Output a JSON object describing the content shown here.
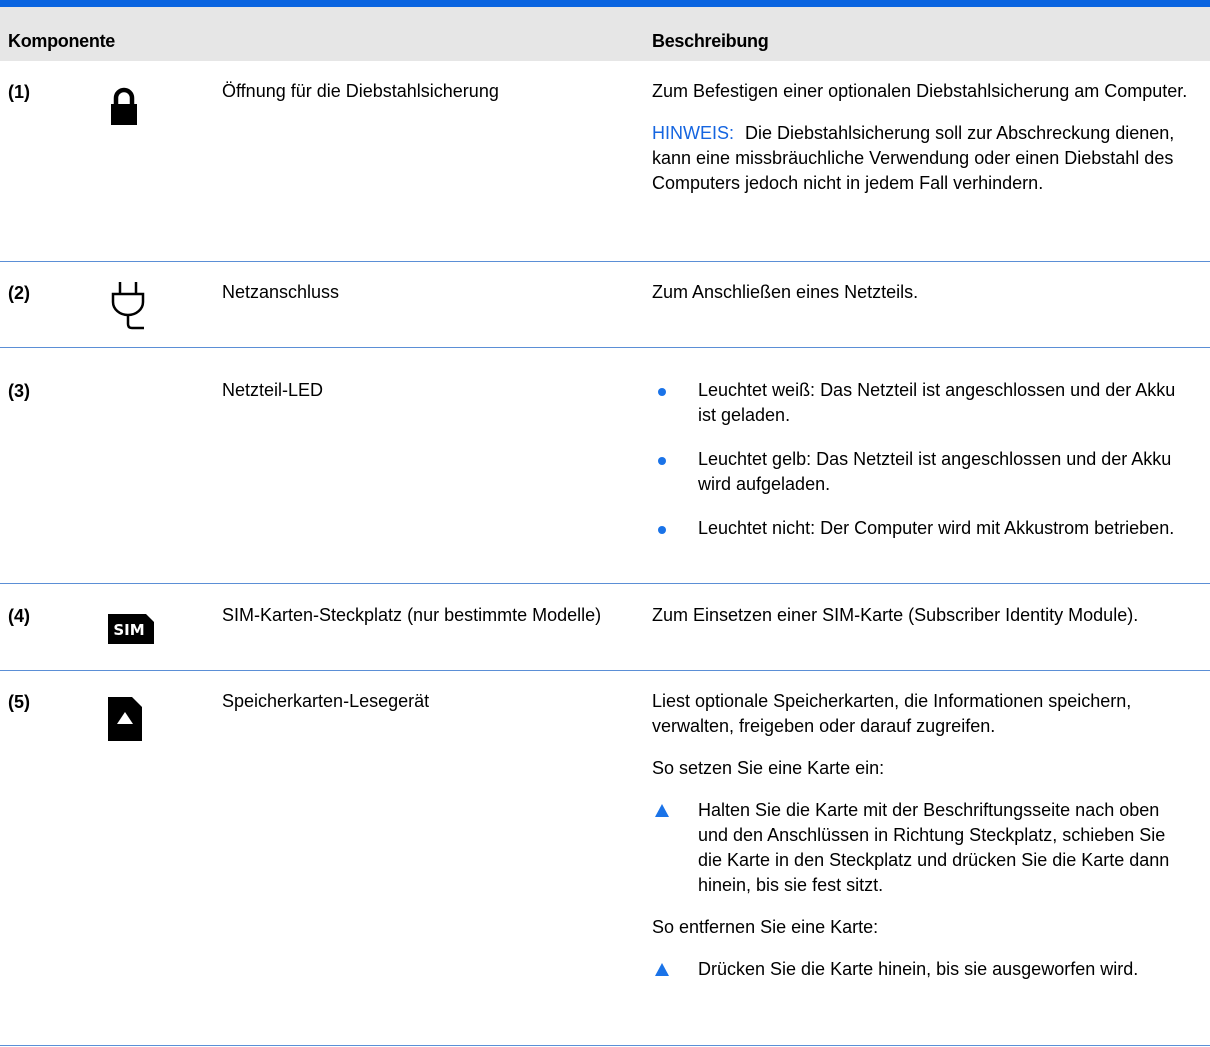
{
  "header": {
    "component": "Komponente",
    "description": "Beschreibung"
  },
  "rows": [
    {
      "num": "(1)",
      "icon": "lock-icon",
      "name": "Öffnung für die Diebstahlsicherung",
      "desc": "Zum Befestigen einer optionalen Diebstahlsicherung am Computer.",
      "note_label": "HINWEIS:",
      "note_text": "Die Diebstahlsicherung soll zur Abschreckung dienen, kann eine missbräuchliche Verwendung oder einen Diebstahl des Computers jedoch nicht in jedem Fall verhindern."
    },
    {
      "num": "(2)",
      "icon": "power-plug-icon",
      "name": "Netzanschluss",
      "desc": "Zum Anschließen eines Netzteils."
    },
    {
      "num": "(3)",
      "name": "Netzteil-LED",
      "bullets": [
        "Leuchtet weiß: Das Netzteil ist angeschlossen und der Akku ist geladen.",
        "Leuchtet gelb: Das Netzteil ist angeschlossen und der Akku wird aufgeladen.",
        "Leuchtet nicht: Der Computer wird mit Akkustrom betrieben."
      ]
    },
    {
      "num": "(4)",
      "icon": "sim-card-icon",
      "icon_text": "SIM",
      "name": "SIM-Karten-Steckplatz (nur bestimmte Modelle)",
      "desc": "Zum Einsetzen einer SIM-Karte (Subscriber Identity Module)."
    },
    {
      "num": "(5)",
      "icon": "memory-card-icon",
      "name": "Speicherkarten-Lesegerät",
      "desc": "Liest optionale Speicherkarten, die Informationen speichern, verwalten, freigeben oder darauf zugreifen.",
      "insert_heading": "So setzen Sie eine Karte ein:",
      "insert_step": "Halten Sie die Karte mit der Beschriftungsseite nach oben und den Anschlüssen in Richtung Steckplatz, schieben Sie die Karte in den Steckplatz und drücken Sie die Karte dann hinein, bis sie fest sitzt.",
      "remove_heading": "So entfernen Sie eine Karte:",
      "remove_step": "Drücken Sie die Karte hinein, bis sie ausgeworfen wird."
    }
  ],
  "colors": {
    "accent": "#1a73e8",
    "rule": "#0a64e0",
    "header_bg": "#e6e6e6"
  }
}
